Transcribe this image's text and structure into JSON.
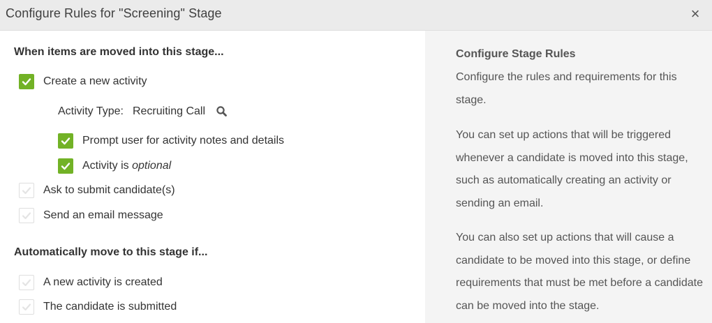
{
  "dialog": {
    "title": "Configure Rules for \"Screening\" Stage",
    "close_glyph": "×",
    "close_icon": "close-icon"
  },
  "rules": {
    "moved_into_heading": "When items are moved into this stage...",
    "create_activity": {
      "label": "Create a new activity",
      "checked": true
    },
    "activity_type_label": "Activity Type:",
    "activity_type_value": "Recruiting Call",
    "prompt_notes": {
      "label": "Prompt user for activity notes and details",
      "checked": true
    },
    "activity_optional": {
      "label_prefix": "Activity is ",
      "label_emphasis": "optional",
      "checked": true
    },
    "submit_candidate": {
      "label": "Ask to submit candidate(s)",
      "checked": false
    },
    "send_email": {
      "label": "Send an email message",
      "checked": false
    },
    "auto_move_heading": "Automatically move to this stage if...",
    "activity_created": {
      "label": "A new activity is created",
      "checked": false
    },
    "candidate_submitted": {
      "label": "The candidate is submitted",
      "checked": false
    }
  },
  "info": {
    "title": "Configure Stage Rules",
    "paragraphs": [
      "Configure the rules and requirements for this stage.",
      "You can set up actions that will be triggered whenever a candidate is moved into this stage, such as automatically creating an activity or sending an email.",
      "You can also set up actions that will cause a candidate to be moved into this stage, or define requirements that must be met before a candidate can be moved into the stage."
    ]
  },
  "colors": {
    "checked_green": "#72b226",
    "header_bg": "#ebebeb",
    "info_panel_bg": "#f4f4f4"
  }
}
